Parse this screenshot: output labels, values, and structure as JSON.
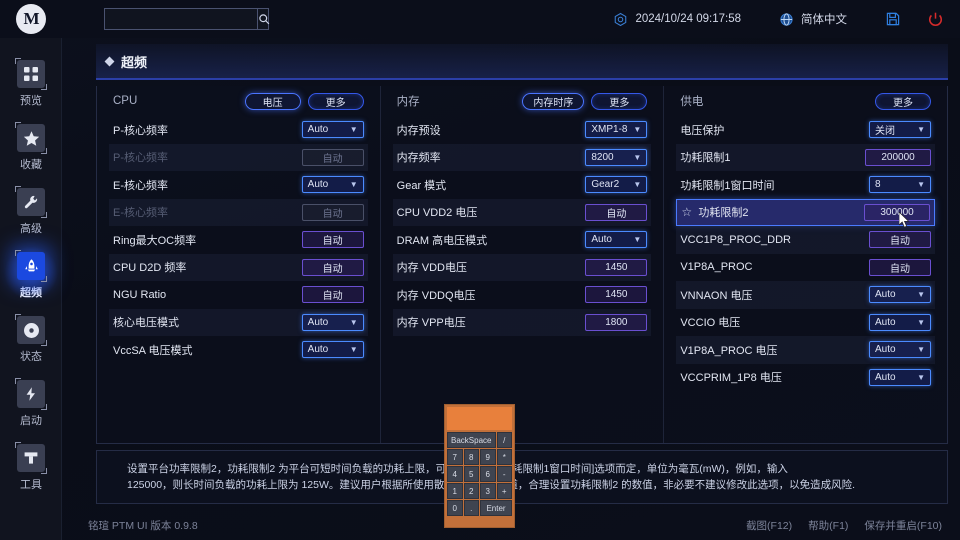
{
  "header": {
    "search_value": "",
    "search_placeholder": "",
    "datetime": "2024/10/24 09:17:58",
    "language": "简体中文"
  },
  "sidebar": {
    "items": [
      {
        "label": "预览",
        "icon": "grid-icon",
        "active": false
      },
      {
        "label": "收藏",
        "icon": "star-icon",
        "active": false
      },
      {
        "label": "高级",
        "icon": "wrench-icon",
        "active": false
      },
      {
        "label": "超频",
        "icon": "rocket-icon",
        "active": true
      },
      {
        "label": "状态",
        "icon": "gauge-icon",
        "active": false
      },
      {
        "label": "启动",
        "icon": "ssd-boot-icon",
        "active": false
      },
      {
        "label": "工具",
        "icon": "toolbox-icon",
        "active": false
      }
    ]
  },
  "page": {
    "title": "超频"
  },
  "columns": [
    {
      "title": "CPU",
      "buttons": [
        {
          "label": "电压",
          "strong": true
        },
        {
          "label": "更多",
          "strong": false
        }
      ],
      "rows": [
        {
          "label": "P-核心频率",
          "value": "Auto",
          "type": "dropdown",
          "disabled": false
        },
        {
          "label": "P-核心频率",
          "value": "自动",
          "type": "text",
          "disabled": true
        },
        {
          "label": "E-核心频率",
          "value": "Auto",
          "type": "dropdown",
          "disabled": false
        },
        {
          "label": "E-核心频率",
          "value": "自动",
          "type": "text",
          "disabled": true
        },
        {
          "label": "Ring最大OC频率",
          "value": "自动",
          "type": "text",
          "disabled": false
        },
        {
          "label": "CPU D2D 频率",
          "value": "自动",
          "type": "text",
          "disabled": false
        },
        {
          "label": "NGU Ratio",
          "value": "自动",
          "type": "text",
          "disabled": false
        },
        {
          "label": "核心电压模式",
          "value": "Auto",
          "type": "dropdown",
          "disabled": false
        },
        {
          "label": "VccSA 电压模式",
          "value": "Auto",
          "type": "dropdown",
          "disabled": false
        }
      ]
    },
    {
      "title": "内存",
      "buttons": [
        {
          "label": "内存时序",
          "strong": true
        },
        {
          "label": "更多",
          "strong": false
        }
      ],
      "rows": [
        {
          "label": "内存预设",
          "value": "XMP1-8",
          "type": "dropdown",
          "disabled": false
        },
        {
          "label": "内存频率",
          "value": "8200",
          "type": "dropdown",
          "disabled": false
        },
        {
          "label": "Gear 模式",
          "value": "Gear2",
          "type": "dropdown",
          "disabled": false
        },
        {
          "label": "CPU VDD2 电压",
          "value": "自动",
          "type": "text",
          "disabled": false
        },
        {
          "label": "DRAM 高电压模式",
          "value": "Auto",
          "type": "dropdown",
          "disabled": false
        },
        {
          "label": "内存 VDD电压",
          "value": "1450",
          "type": "text",
          "disabled": false
        },
        {
          "label": "内存 VDDQ电压",
          "value": "1450",
          "type": "text",
          "disabled": false
        },
        {
          "label": "内存 VPP电压",
          "value": "1800",
          "type": "text",
          "disabled": false
        }
      ]
    },
    {
      "title": "供电",
      "buttons": [
        {
          "label": "更多",
          "strong": false
        }
      ],
      "rows": [
        {
          "label": "电压保护",
          "value": "关闭",
          "type": "dropdown",
          "disabled": false
        },
        {
          "label": "功耗限制1",
          "value": "200000",
          "type": "text",
          "disabled": false
        },
        {
          "label": "功耗限制1窗口时间",
          "value": "8",
          "type": "dropdown",
          "disabled": false
        },
        {
          "label": "功耗限制2",
          "value": "300000",
          "type": "text",
          "disabled": false,
          "selected": true
        },
        {
          "label": "VCC1P8_PROC_DDR",
          "value": "自动",
          "type": "text",
          "disabled": false
        },
        {
          "label": "V1P8A_PROC",
          "value": "自动",
          "type": "text",
          "disabled": false
        },
        {
          "label": "VNNAON 电压",
          "value": "Auto",
          "type": "dropdown",
          "disabled": false
        },
        {
          "label": "VCCIO 电压",
          "value": "Auto",
          "type": "dropdown",
          "disabled": false
        },
        {
          "label": "V1P8A_PROC 电压",
          "value": "Auto",
          "type": "dropdown",
          "disabled": false
        },
        {
          "label": "VCCPRIM_1P8 电压",
          "value": "Auto",
          "type": "dropdown",
          "disabled": false
        }
      ]
    }
  ],
  "help": {
    "line1": "设置平台功率限制2，功耗限制2 为平台可短时间负载的功耗上限，可负载时间由[功耗限制1窗口时间]选项而定，单位为毫瓦(mW)，例如，输入",
    "line2": "125000，则长时间负载的功耗上限为 125W。建议用户根据所使用散热器和机箱风道，合理设置功耗限制2 的数值，非必要不建议修改此选项，以免造成风险."
  },
  "keypad": {
    "display": "",
    "keys": [
      "BackSpace",
      "/",
      "7",
      "8",
      "9",
      "*",
      "4",
      "5",
      "6",
      "-",
      "1",
      "2",
      "3",
      "+",
      "0",
      ".",
      "Enter"
    ]
  },
  "footer": {
    "version": "铭瑄 PTM UI 版本 0.9.8",
    "hotkeys": [
      "截图(F12)",
      "帮助(F1)",
      "保存并重启(F10)"
    ]
  },
  "colors": {
    "accent_blue": "#4b7bff",
    "purple_field": "#6a4fd0",
    "orange_keypad": "#e8803c",
    "power_red": "#d62b2b",
    "save_blue": "#2f7fe0"
  }
}
